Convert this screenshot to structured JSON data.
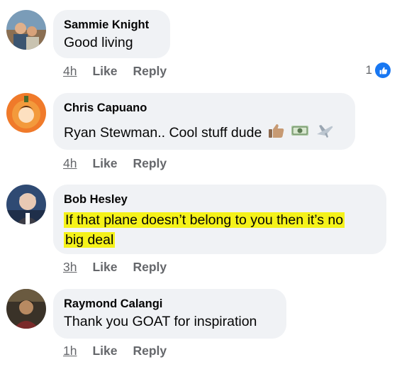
{
  "comments": [
    {
      "author": "Sammie Knight",
      "text": "Good living",
      "time": "4h",
      "like_label": "Like",
      "reply_label": "Reply",
      "reaction_count": "1"
    },
    {
      "author": "Chris Capuano",
      "text": "Ryan Stewman.. Cool stuff dude",
      "emojis": [
        "thumbs-up",
        "money-bag",
        "airplane"
      ],
      "time": "4h",
      "like_label": "Like",
      "reply_label": "Reply"
    },
    {
      "author": "Bob Hesley",
      "text_line1": "If that plane doesn’t belong to you then it’s no",
      "text_line2": "big deal",
      "highlight_color": "#f5f21a",
      "time": "3h",
      "like_label": "Like",
      "reply_label": "Reply"
    },
    {
      "author": "Raymond Calangi",
      "text": "Thank you GOAT for inspiration",
      "time": "1h",
      "like_label": "Like",
      "reply_label": "Reply"
    }
  ],
  "colors": {
    "bubble": "#f0f2f5",
    "meta": "#65676b",
    "like_badge": "#1877f2"
  }
}
